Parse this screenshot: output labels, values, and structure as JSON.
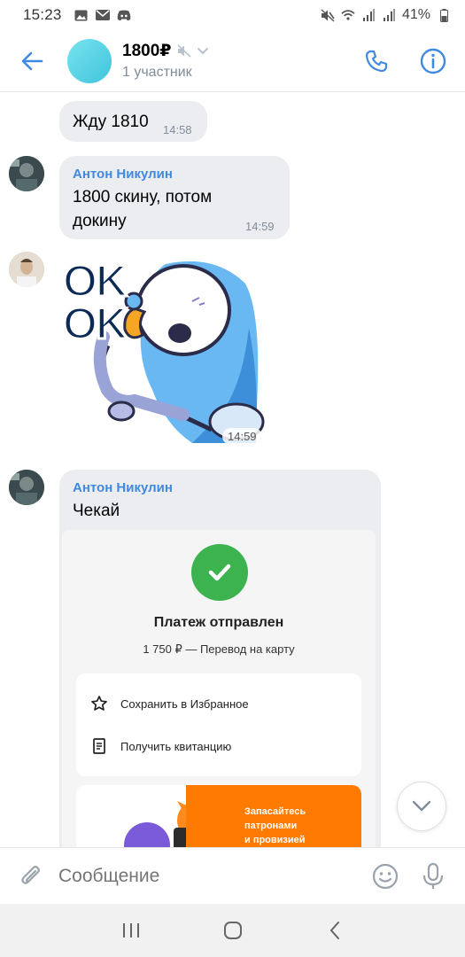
{
  "status_bar": {
    "time": "15:23",
    "battery": "41%",
    "left_icons": [
      "image-icon",
      "mail-icon",
      "discord-icon"
    ],
    "right_icons": [
      "mute-icon",
      "wifi-icon",
      "signal-icon",
      "signal-icon",
      "battery-icon"
    ]
  },
  "header": {
    "title": "1800₽",
    "subtitle": "1 участник",
    "accent": "#3f8ae0"
  },
  "messages": [
    {
      "text": "Жду 1810",
      "time": "14:58"
    },
    {
      "sender": "Антон Никулин",
      "text_line1": "1800 скину, потом",
      "text_line2": "докину",
      "time": "14:59"
    },
    {
      "sticker_text_1": "OK",
      "sticker_text_2": "OK",
      "time": "14:59"
    },
    {
      "sender": "Антон Никулин",
      "text": "Чекай"
    }
  ],
  "payment_card": {
    "title": "Платеж отправлен",
    "subtitle": "1 750 ₽ — Перевод на карту",
    "action_1": "Сохранить в Избранное",
    "action_2": "Получить квитанцию",
    "promo_line1": "Запасайтесь",
    "promo_line2": "патронами",
    "promo_line3": "и провизией"
  },
  "composer": {
    "placeholder": "Сообщение"
  },
  "colors": {
    "bubble": "#ebedf0",
    "sender": "#3f8ae0",
    "success": "#3cb34f",
    "promo": "#ff7a00"
  }
}
